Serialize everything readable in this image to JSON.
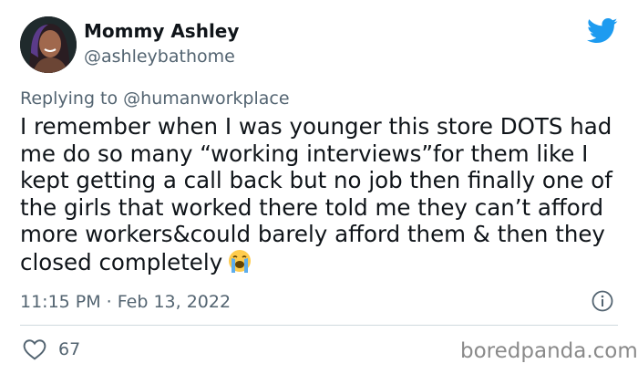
{
  "author": {
    "display_name": "Mommy Ashley",
    "handle": "@ashleybathome"
  },
  "reply": {
    "prefix": "Replying to ",
    "mention": "@humanworkplace"
  },
  "tweet": {
    "text": "I remember when I was younger this store DOTS had me do so many “working interviews”for them like I kept getting a call back but no job then finally one of the girls that worked there told me they can’t afford more workers&could barely afford them & then they closed completely",
    "emoji": "loudly-crying-face",
    "timestamp": "11:15 PM · Feb 13, 2022"
  },
  "engagement": {
    "likes": "67"
  },
  "icons": {
    "brand": "twitter-bird-icon",
    "info": "info-icon",
    "like": "heart-icon"
  },
  "colors": {
    "brand": "#1d9bf0",
    "text": "#0f1419",
    "secondary": "#536471",
    "divider": "#cfd9de"
  },
  "watermark": "boredpanda.com"
}
